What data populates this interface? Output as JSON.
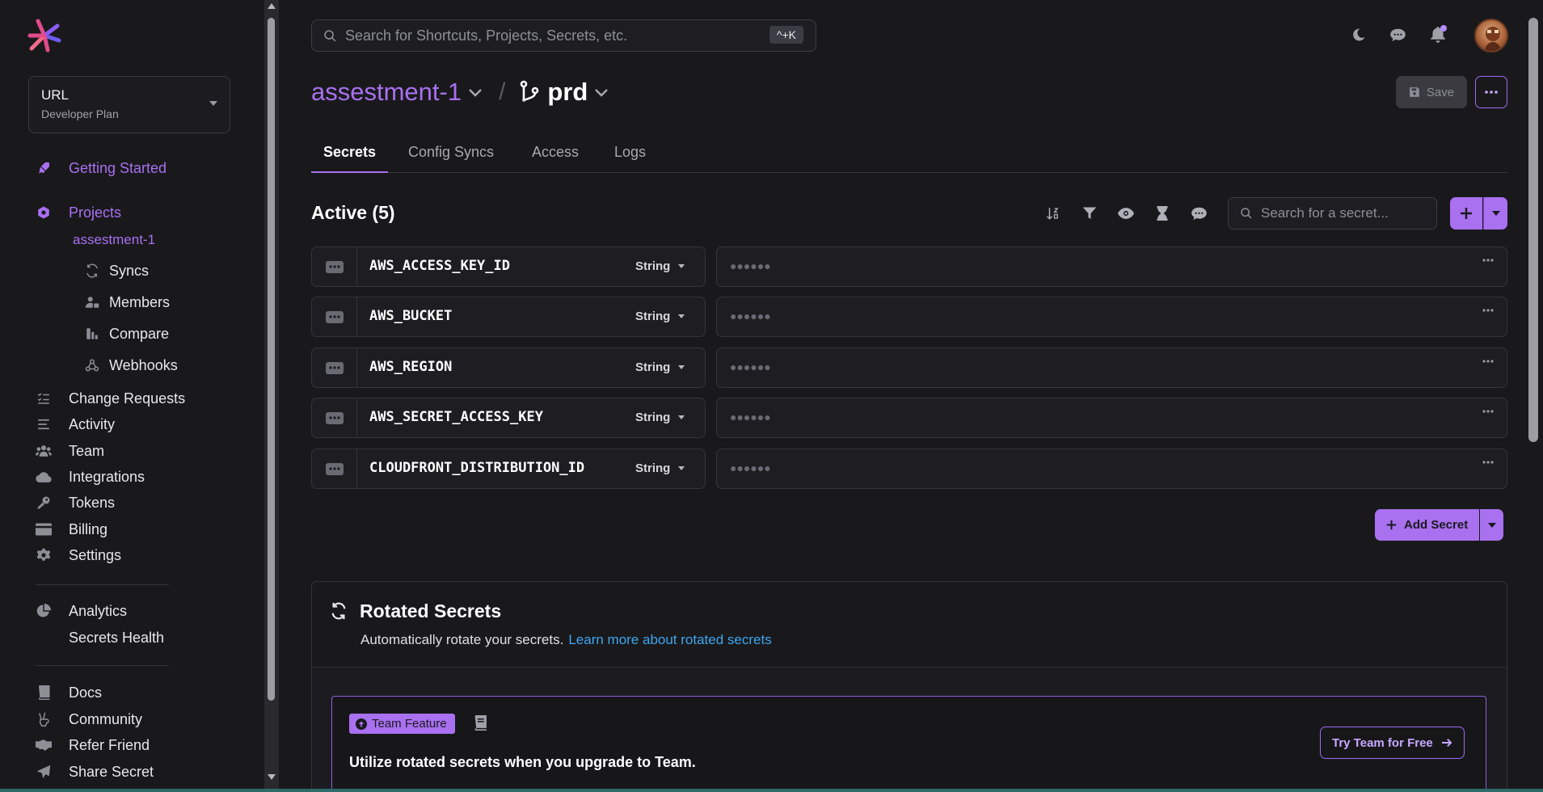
{
  "org": {
    "name": "URL",
    "plan": "Developer Plan"
  },
  "nav": {
    "getting_started": "Getting Started",
    "projects": "Projects",
    "project_name": "assestment-1",
    "sub": {
      "syncs": "Syncs",
      "members": "Members",
      "compare": "Compare",
      "webhooks": "Webhooks"
    },
    "change_requests": "Change Requests",
    "activity": "Activity",
    "team": "Team",
    "integrations": "Integrations",
    "tokens": "Tokens",
    "billing": "Billing",
    "settings": "Settings",
    "analytics": "Analytics",
    "secrets_health": "Secrets Health",
    "docs": "Docs",
    "community": "Community",
    "refer_friend": "Refer Friend",
    "share_secret": "Share Secret"
  },
  "search": {
    "placeholder": "Search for Shortcuts, Projects, Secrets, etc.",
    "shortcut": "^+K"
  },
  "header": {
    "project": "assestment-1",
    "environment": "prd",
    "save_label": "Save"
  },
  "tabs": [
    "Secrets",
    "Config Syncs",
    "Access",
    "Logs"
  ],
  "secrets": {
    "title": "Active (5)",
    "search_placeholder": "Search for a secret...",
    "masked": "●●●●●●",
    "rows": [
      {
        "key": "AWS_ACCESS_KEY_ID",
        "type": "String"
      },
      {
        "key": "AWS_BUCKET",
        "type": "String"
      },
      {
        "key": "AWS_REGION",
        "type": "String"
      },
      {
        "key": "AWS_SECRET_ACCESS_KEY",
        "type": "String"
      },
      {
        "key": "CLOUDFRONT_DISTRIBUTION_ID",
        "type": "String"
      }
    ],
    "add_label": "Add Secret"
  },
  "rotated": {
    "title": "Rotated Secrets",
    "description": "Automatically rotate your secrets.",
    "link": "Learn more about rotated secrets",
    "badge": "Team Feature",
    "upgrade_text": "Utilize rotated secrets when you upgrade to Team.",
    "try_label": "Try Team for Free"
  },
  "colors": {
    "accent": "#a970f0",
    "link": "#3fa6f0",
    "background": "#19191c"
  }
}
